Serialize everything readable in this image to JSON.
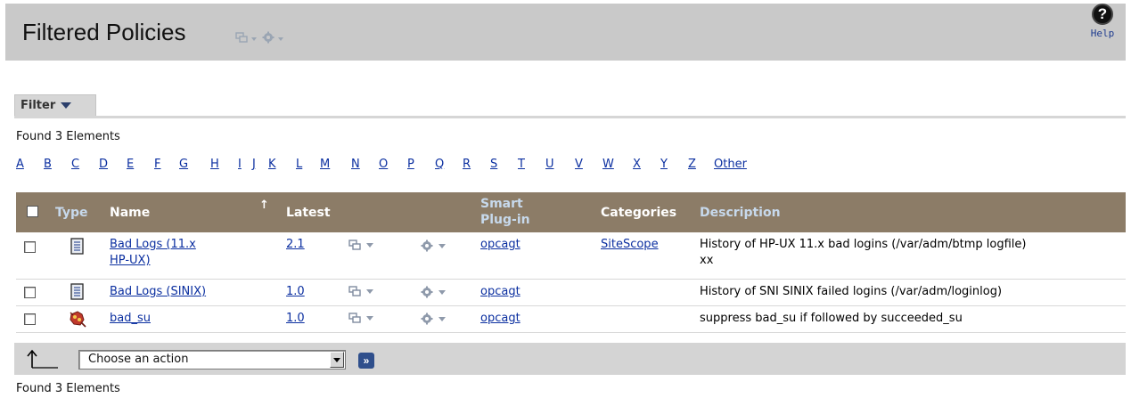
{
  "page": {
    "title": "Filtered Policies",
    "help_label": "Help"
  },
  "filter": {
    "label": "Filter"
  },
  "found_text": "Found 3 Elements",
  "alphabet": [
    "A",
    "B",
    "C",
    "D",
    "E",
    "F",
    "G",
    "H",
    "I",
    "J",
    "K",
    "L",
    "M",
    "N",
    "O",
    "P",
    "Q",
    "R",
    "S",
    "T",
    "U",
    "V",
    "W",
    "X",
    "Y",
    "Z",
    "Other"
  ],
  "table": {
    "headers": {
      "type": "Type",
      "name": "Name",
      "latest": "Latest",
      "smart_plugin_1": "Smart",
      "smart_plugin_2": "Plug-in",
      "categories": "Categories",
      "description": "Description"
    },
    "sorted_by": "Name",
    "rows": [
      {
        "name_line1": "Bad Logs (11.x",
        "name_line2": "HP-UX)",
        "type_icon": "document-icon",
        "latest": "2.1",
        "smart_plugin": "opcagt",
        "categories": "SiteScope",
        "description_line1": "History of HP-UX 11.x bad logins (/var/adm/btmp logfile)",
        "description_line2": "xx"
      },
      {
        "name": "Bad Logs (SINIX)",
        "type_icon": "document-icon",
        "latest": "1.0",
        "smart_plugin": "opcagt",
        "categories": "",
        "description": "History of SNI SINIX failed logins (/var/adm/loginlog)"
      },
      {
        "name": "bad_su",
        "type_icon": "event-correlation-icon",
        "latest": "1.0",
        "smart_plugin": "opcagt",
        "categories": "",
        "description": "suppress bad_su if followed by succeeded_su"
      }
    ]
  },
  "actions": {
    "select_value": "Choose an action",
    "go_label": "»"
  },
  "colors": {
    "header_bg": "#c9c9c9",
    "table_header_bg": "#8c7c67",
    "link": "#0b2fa0",
    "go_button": "#2f4f8c"
  }
}
